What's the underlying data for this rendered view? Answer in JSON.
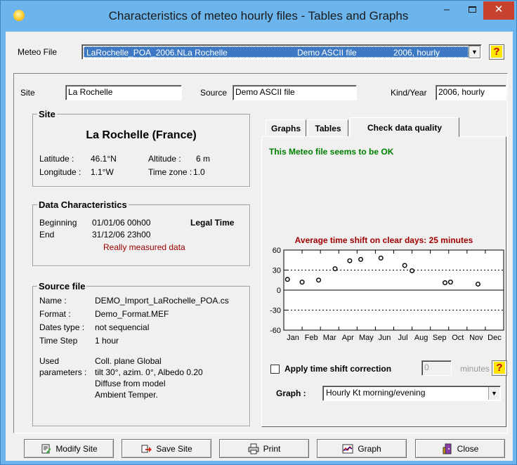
{
  "window": {
    "title": "Characteristics of meteo  hourly files  -  Tables and Graphs",
    "controls": {
      "minimize": "–",
      "maximize": "",
      "close": "✕"
    }
  },
  "meteo": {
    "label": "Meteo File",
    "selected_file": "LaRochelle_POA_2006.NLa Rochelle",
    "selected_source": "Demo ASCII file",
    "selected_kind": "2006, hourly",
    "help": "?"
  },
  "header_fields": {
    "site_label": "Site",
    "site_value": "La Rochelle",
    "source_label": "Source",
    "source_value": "Demo ASCII file",
    "kind_label": "Kind/Year",
    "kind_value": "2006, hourly"
  },
  "site_box": {
    "title": "Site",
    "name": "La Rochelle   (France)",
    "latitude_label": "Latitude :",
    "latitude_value": "46.1°N",
    "longitude_label": "Longitude :",
    "longitude_value": "1.1°W",
    "altitude_label": "Altitude :",
    "altitude_value": "6 m",
    "timezone_label": "Time zone :",
    "timezone_value": "1.0"
  },
  "data_characteristics": {
    "title": "Data Characteristics",
    "beginning_label": "Beginning",
    "beginning_value": "01/01/06 00h00",
    "end_label": "End",
    "end_value": "31/12/06 23h00",
    "time_type": "Legal Time",
    "note": "Really measured data"
  },
  "source_file": {
    "title": "Source file",
    "name_label": "Name :",
    "name_value": "DEMO_Import_LaRochelle_POA.cs",
    "format_label": "Format :",
    "format_value": "Demo_Format.MEF",
    "dates_label": "Dates type :",
    "dates_value": "not sequencial",
    "step_label": "Time Step",
    "step_value": "1 hour",
    "used_label": "Used",
    "params_label": "parameters :",
    "param_1": "Coll. plane Global",
    "param_2": "tilt 30°, azim. 0°, Albedo 0.20",
    "param_3": "Diffuse from model",
    "param_4": "Ambient Temper."
  },
  "tabs": {
    "graphs": "Graphs",
    "tables": "Tables",
    "quality": "Check data quality"
  },
  "quality": {
    "status": "This Meteo file seems to be OK",
    "shift_title": "Average time shift on clear days: 25 minutes",
    "apply_label": "Apply time shift correction",
    "apply_checked": false,
    "minutes_value": "0",
    "minutes_label": "minutes",
    "help": "?",
    "graph_label": "Graph :",
    "graph_selected": "Hourly Kt morning/evening"
  },
  "chart_data": {
    "type": "scatter",
    "title": "Average time shift on clear days: 25 minutes",
    "ylim": [
      -60,
      60
    ],
    "yticks": [
      "60",
      "30",
      "0",
      "-30",
      "-60"
    ],
    "ytick_values": [
      60,
      30,
      0,
      -30,
      -60
    ],
    "xticks": [
      "Jan",
      "Feb",
      "Mar",
      "Apr",
      "May",
      "Jun",
      "Jul",
      "Aug",
      "Sep",
      "Oct",
      "Nov",
      "Dec"
    ],
    "xlim": [
      0,
      12
    ],
    "dotted_lines": [
      30,
      -30
    ],
    "solid_lines": [
      0
    ],
    "points": [
      {
        "x": 0.2,
        "y": 16
      },
      {
        "x": 1.0,
        "y": 12
      },
      {
        "x": 1.9,
        "y": 15
      },
      {
        "x": 2.8,
        "y": 32
      },
      {
        "x": 3.6,
        "y": 44
      },
      {
        "x": 4.2,
        "y": 46
      },
      {
        "x": 5.3,
        "y": 48
      },
      {
        "x": 6.6,
        "y": 37
      },
      {
        "x": 7.0,
        "y": 29
      },
      {
        "x": 8.8,
        "y": 11
      },
      {
        "x": 9.1,
        "y": 12
      },
      {
        "x": 10.6,
        "y": 9
      }
    ]
  },
  "buttons": {
    "modify_site": "Modify Site",
    "save_site": "Save Site",
    "print": "Print",
    "graph": "Graph",
    "close": "Close"
  },
  "colors": {
    "ok_green": "#008000",
    "dark_red": "#a00000",
    "title_blue": "#6cb4ec",
    "close_red": "#c7412f",
    "selection_blue": "#3d78c4"
  }
}
